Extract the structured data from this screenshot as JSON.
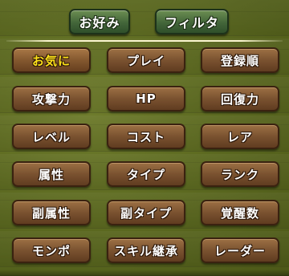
{
  "header": {
    "favorite_label": "お好み",
    "filter_label": "フィルタ"
  },
  "sort_options": [
    {
      "label": "お気に",
      "selected": true
    },
    {
      "label": "プレイ",
      "selected": false
    },
    {
      "label": "登録順",
      "selected": false
    },
    {
      "label": "攻撃力",
      "selected": false
    },
    {
      "label": "HP",
      "selected": false
    },
    {
      "label": "回復力",
      "selected": false
    },
    {
      "label": "レベル",
      "selected": false
    },
    {
      "label": "コスト",
      "selected": false
    },
    {
      "label": "レア",
      "selected": false
    },
    {
      "label": "属性",
      "selected": false
    },
    {
      "label": "タイプ",
      "selected": false
    },
    {
      "label": "ランク",
      "selected": false
    },
    {
      "label": "副属性",
      "selected": false
    },
    {
      "label": "副タイプ",
      "selected": false
    },
    {
      "label": "覚醒数",
      "selected": false
    },
    {
      "label": "モンポ",
      "selected": false
    },
    {
      "label": "スキル継承",
      "selected": false
    },
    {
      "label": "レーダー",
      "selected": false
    }
  ],
  "colors": {
    "button_fill": "#7a5230",
    "selected_text": "#ffe21a",
    "header_button_fill": "#43663a",
    "background": "#6f7f28"
  }
}
